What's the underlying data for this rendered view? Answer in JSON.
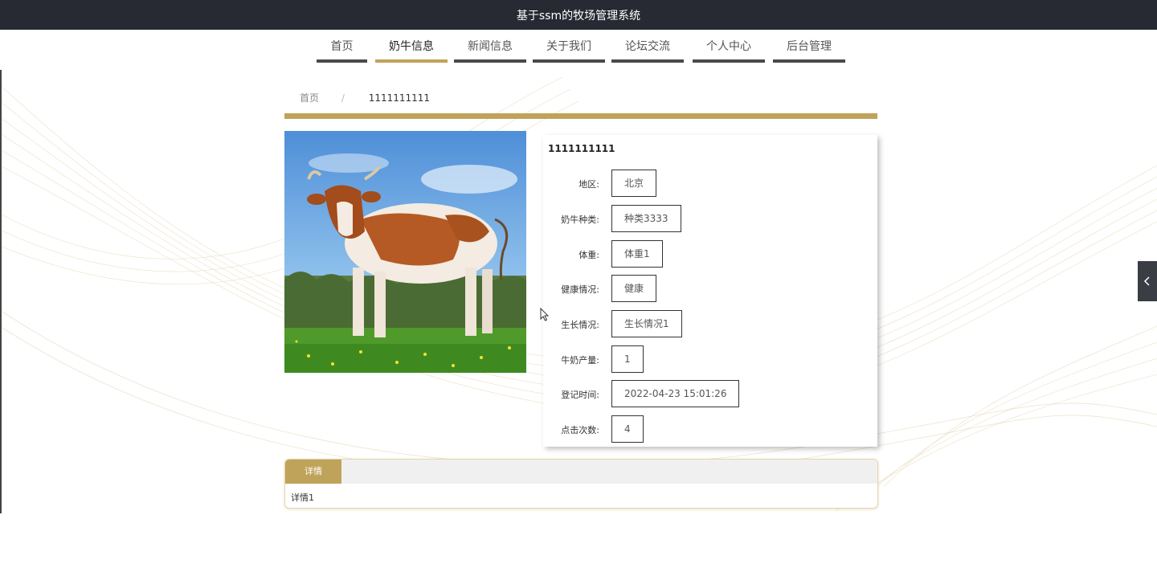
{
  "header": {
    "title": "基于ssm的牧场管理系统"
  },
  "nav": {
    "items": [
      {
        "label": "首页",
        "active": false
      },
      {
        "label": "奶牛信息",
        "active": true
      },
      {
        "label": "新闻信息",
        "active": false
      },
      {
        "label": "关于我们",
        "active": false
      },
      {
        "label": "论坛交流",
        "active": false
      },
      {
        "label": "个人中心",
        "active": false
      },
      {
        "label": "后台管理",
        "active": false
      }
    ]
  },
  "breadcrumb": {
    "home": "首页",
    "separator": "/",
    "current": "1111111111"
  },
  "cow": {
    "title": "1111111111",
    "fields": [
      {
        "label": "地区:",
        "value": "北京"
      },
      {
        "label": "奶牛种类:",
        "value": "种类3333"
      },
      {
        "label": "体重:",
        "value": "体重1"
      },
      {
        "label": "健康情况:",
        "value": "健康"
      },
      {
        "label": "生长情况:",
        "value": "生长情况1"
      },
      {
        "label": "牛奶产量:",
        "value": "1"
      },
      {
        "label": "登记时间:",
        "value": "2022-04-23 15:01:26"
      },
      {
        "label": "点击次数:",
        "value": "4"
      }
    ]
  },
  "detail": {
    "tab_label": "详情",
    "content": "详情1"
  },
  "icons": {
    "side_toggle": "chevron-left-icon",
    "cursor": "mouse-pointer-icon"
  },
  "colors": {
    "accent": "#c0a35a",
    "topbar": "#272a33",
    "nav_bar": "#4a4a4a"
  }
}
